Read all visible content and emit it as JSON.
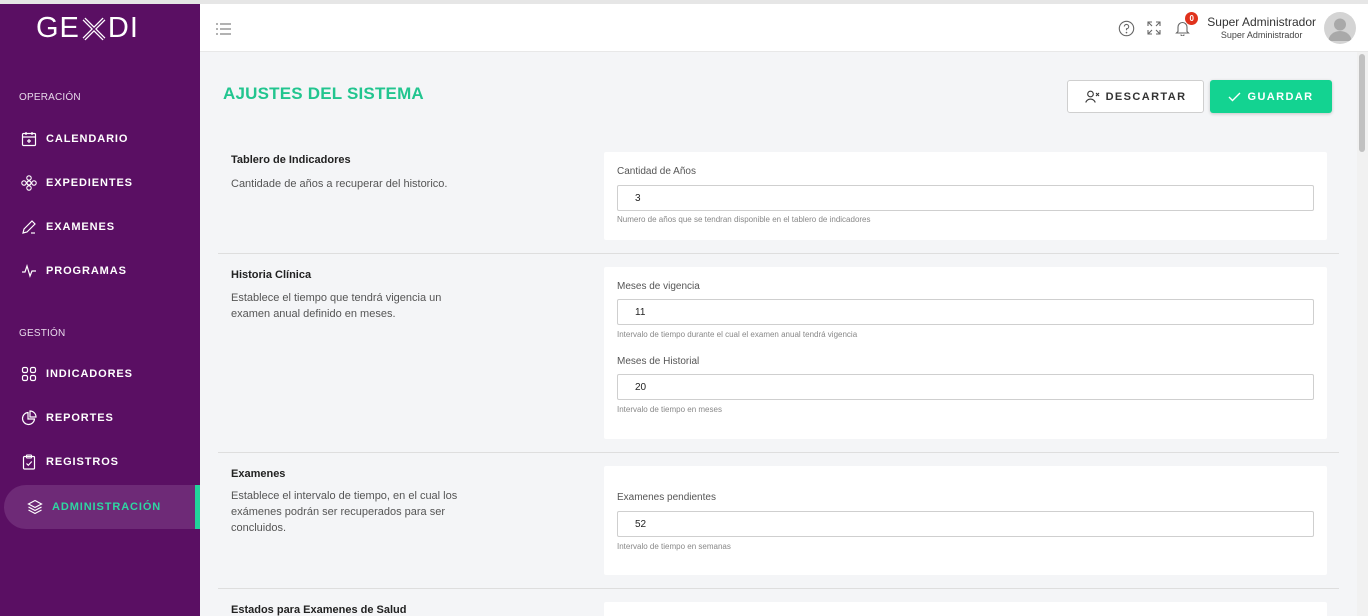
{
  "brand": {
    "logo_left": "GE",
    "logo_right": "DI"
  },
  "sidebar": {
    "section_operacion": "OPERACIÓN",
    "section_gestion": "GESTIÓN",
    "items": [
      {
        "label": "CALENDARIO",
        "icon": "calendar-icon"
      },
      {
        "label": "EXPEDIENTES",
        "icon": "flower-icon"
      },
      {
        "label": "EXAMENES",
        "icon": "pencil-icon"
      },
      {
        "label": "PROGRAMAS",
        "icon": "pulse-icon"
      },
      {
        "label": "INDICADORES",
        "icon": "grid-icon"
      },
      {
        "label": "REPORTES",
        "icon": "pie-chart-icon"
      },
      {
        "label": "REGISTROS",
        "icon": "clipboard-icon"
      },
      {
        "label": "ADMINISTRACIÓN",
        "icon": "layers-icon",
        "active": true
      }
    ],
    "active_color": "#2ed8a2",
    "background": "#5a0f63"
  },
  "topbar": {
    "user_name": "Super Administrador",
    "user_role": "Super Administrador",
    "notification_count": "0"
  },
  "page": {
    "title": "AJUSTES DEL SISTEMA",
    "discard_label": "DESCARTAR",
    "save_label": "GUARDAR",
    "accent": "#13d391"
  },
  "sections": [
    {
      "title": "Tablero de Indicadores",
      "description": "Cantidade de años a recuperar del historico.",
      "fields": [
        {
          "label": "Cantidad de Años",
          "value": "3",
          "help": "Numero de años que se tendran disponible en el tablero de indicadores"
        }
      ]
    },
    {
      "title": "Historia Clínica",
      "description": "Establece el tiempo que tendrá vigencia un examen anual definido en meses.",
      "fields": [
        {
          "label": "Meses de vigencia",
          "value": "11",
          "help": "Intervalo de tiempo durante el cual el examen anual tendrá vigencia"
        },
        {
          "label": "Meses de Historial",
          "value": "20",
          "help": "Intervalo de tiempo en meses"
        }
      ]
    },
    {
      "title": "Examenes",
      "description": "Establece el intervalo de tiempo, en el cual los exámenes podrán ser recuperados para ser concluidos.",
      "fields": [
        {
          "label": "Examenes pendientes",
          "value": "52",
          "help": "Intervalo de tiempo en semanas"
        }
      ]
    },
    {
      "title": "Estados para Examenes de Salud",
      "description": "",
      "fields": []
    }
  ]
}
